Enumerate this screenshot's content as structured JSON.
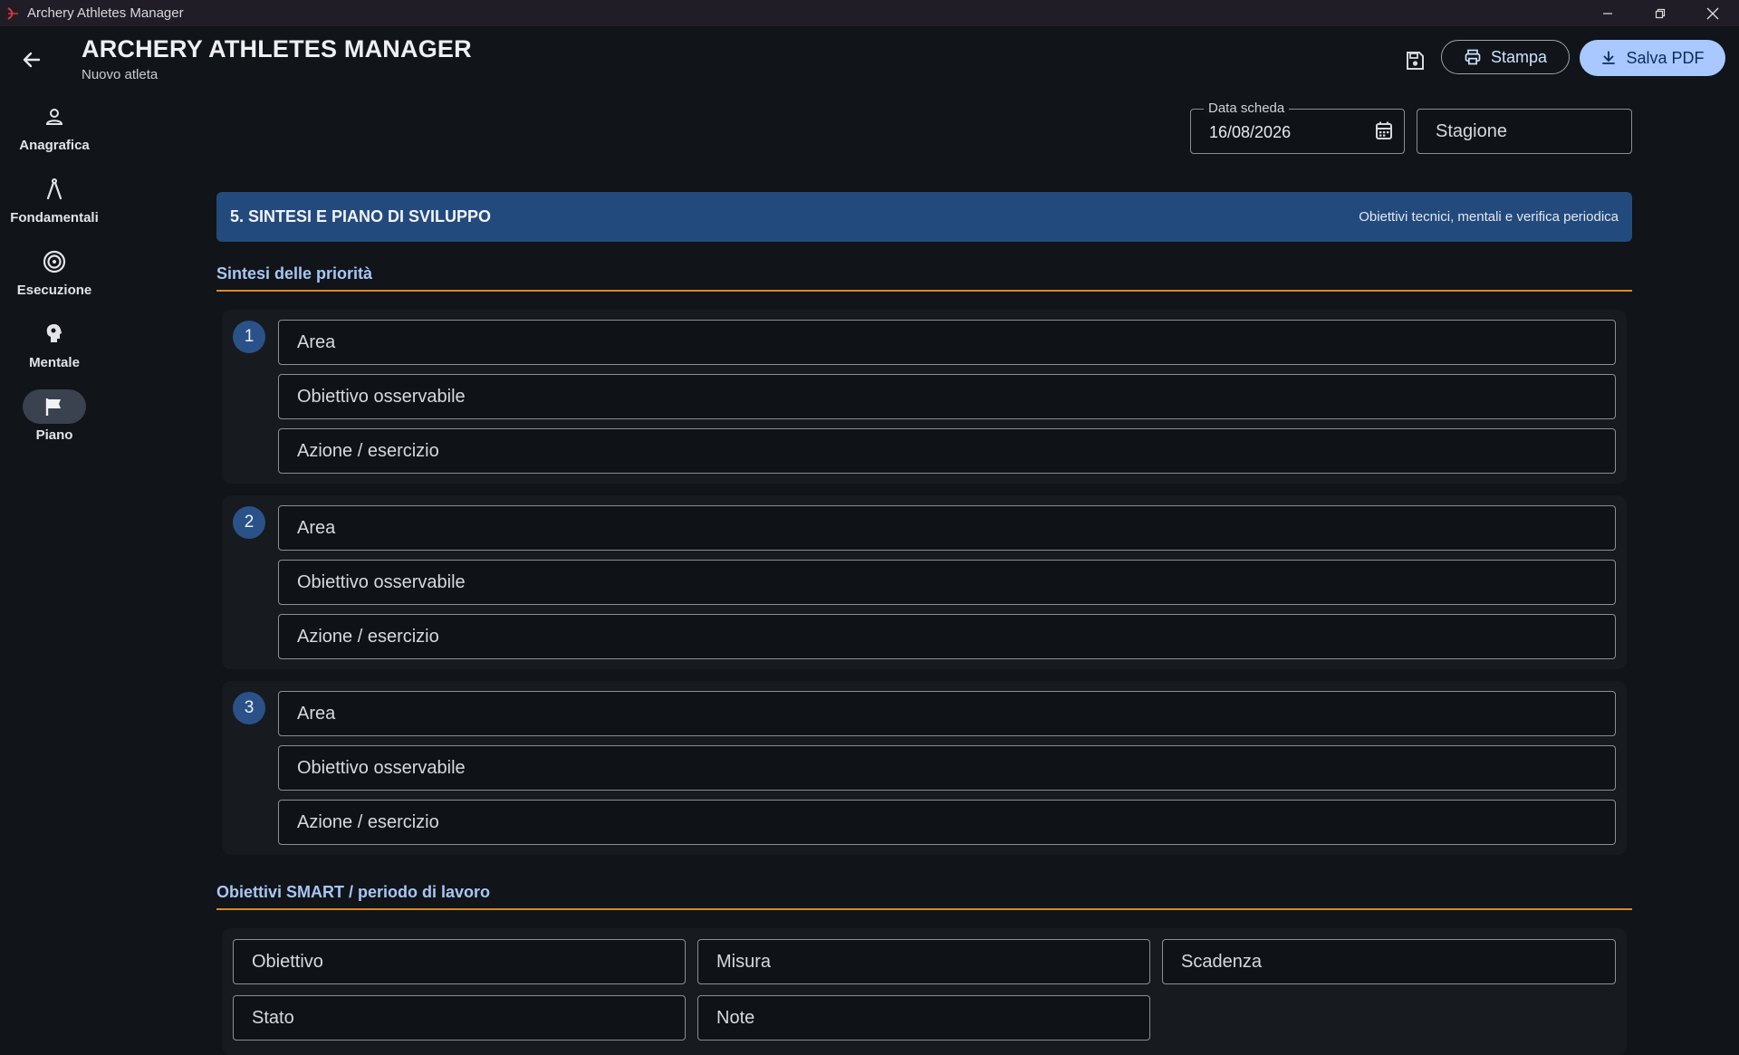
{
  "window": {
    "title": "Archery Athletes Manager"
  },
  "header": {
    "title": "ARCHERY ATHLETES MANAGER",
    "subtitle": "Nuovo atleta",
    "print_label": "Stampa",
    "pdf_label": "Salva PDF"
  },
  "nav": {
    "items": [
      {
        "label": "Anagrafica",
        "icon": "person-icon",
        "active": false
      },
      {
        "label": "Fondamentali",
        "icon": "compass-icon",
        "active": false
      },
      {
        "label": "Esecuzione",
        "icon": "target-icon",
        "active": false
      },
      {
        "label": "Mentale",
        "icon": "brain-icon",
        "active": false
      },
      {
        "label": "Piano",
        "icon": "flag-icon",
        "active": true
      }
    ]
  },
  "meta": {
    "date_label": "Data scheda",
    "date_value": "16/08/2026",
    "season_placeholder": "Stagione"
  },
  "section": {
    "title": "5. SINTESI E PIANO DI SVILUPPO",
    "subtitle": "Obiettivi tecnici, mentali e verifica periodica"
  },
  "priorities": {
    "heading": "Sintesi delle priorità",
    "items": [
      {
        "number": "1",
        "area": "Area",
        "goal": "Obiettivo osservabile",
        "action": "Azione / esercizio"
      },
      {
        "number": "2",
        "area": "Area",
        "goal": "Obiettivo osservabile",
        "action": "Azione / esercizio"
      },
      {
        "number": "3",
        "area": "Area",
        "goal": "Obiettivo osservabile",
        "action": "Azione / esercizio"
      }
    ]
  },
  "smart": {
    "heading": "Obiettivi SMART / periodo di lavoro",
    "objective": "Obiettivo",
    "measure": "Misura",
    "deadline": "Scadenza",
    "status": "Stato",
    "notes": "Note"
  },
  "colors": {
    "accent": "#a8c8ff",
    "section_bar": "#234a7c",
    "rule": "#d88b1e",
    "background": "#111418"
  }
}
